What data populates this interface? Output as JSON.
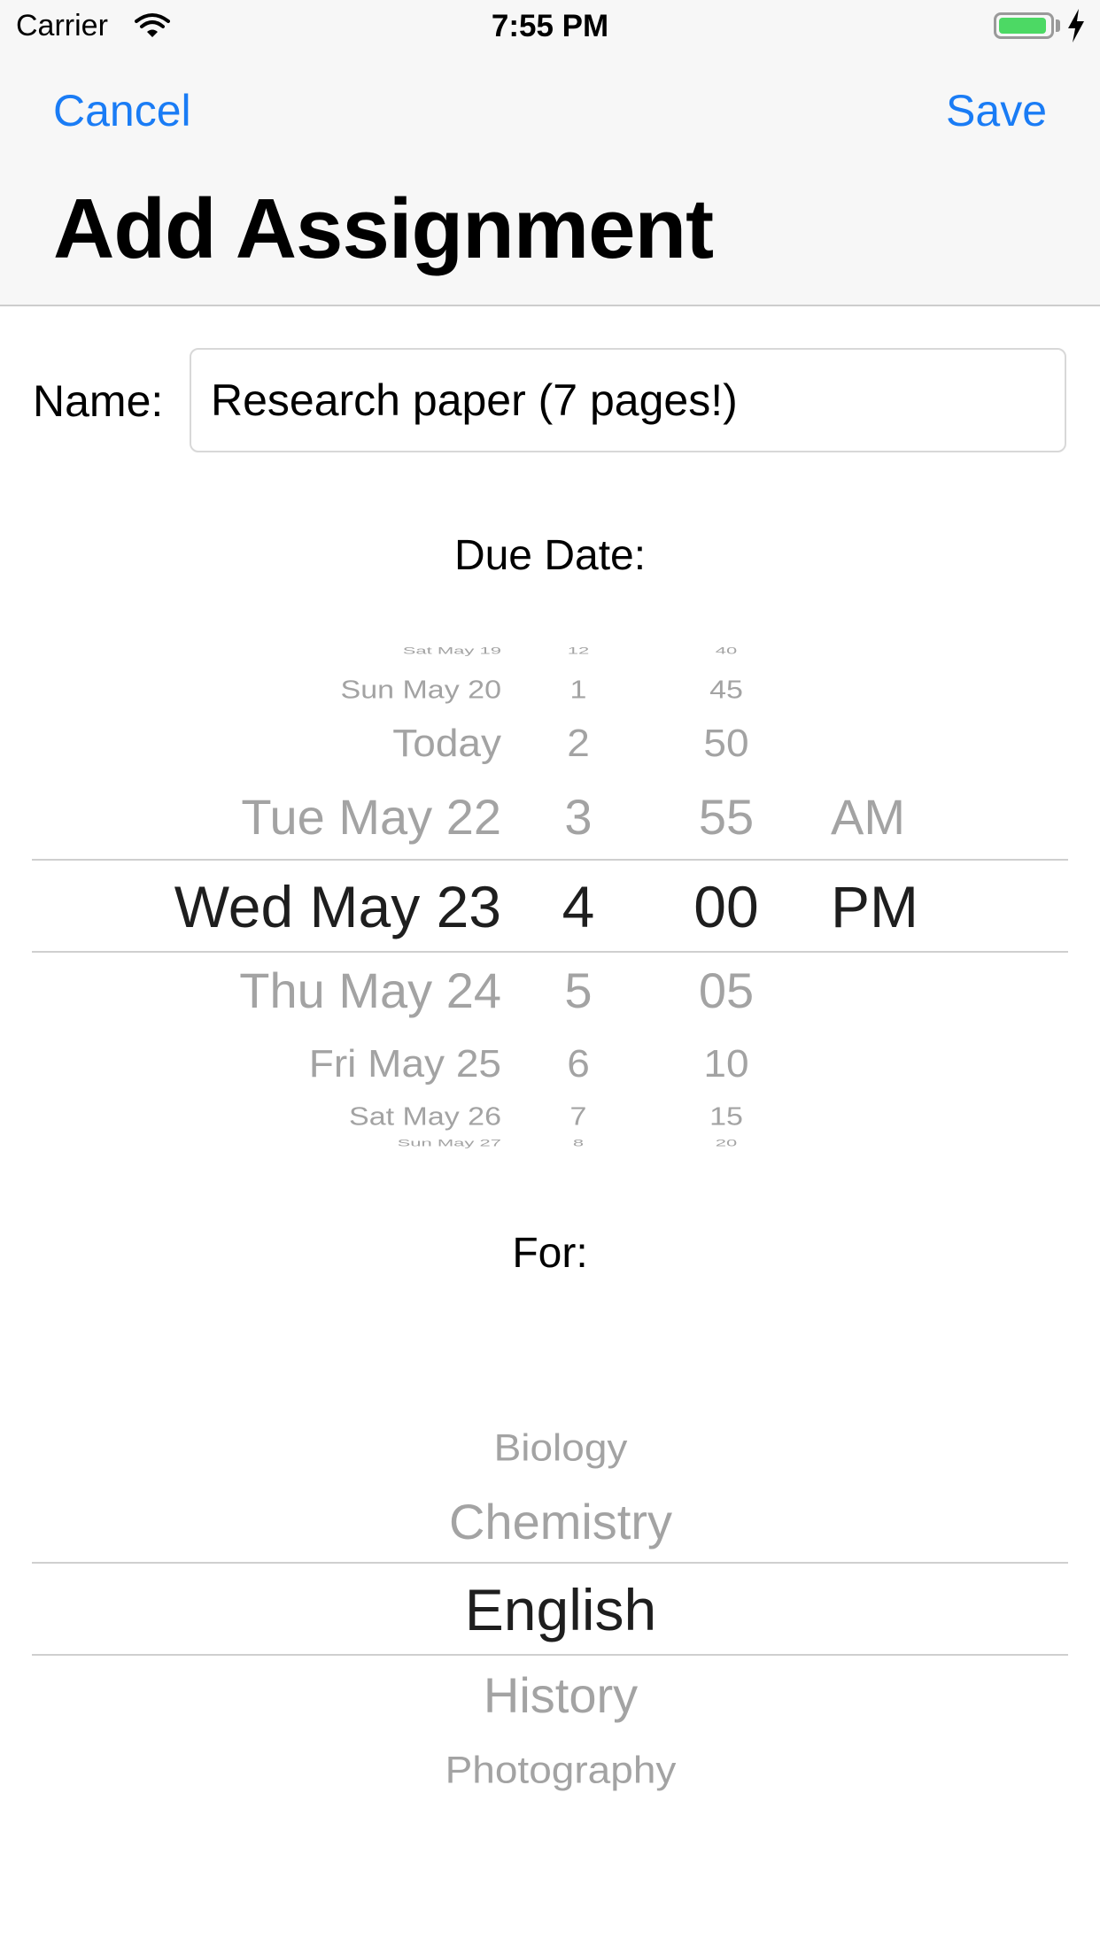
{
  "status_bar": {
    "carrier": "Carrier",
    "time": "7:55 PM",
    "battery_level": 0.95
  },
  "nav": {
    "cancel_label": "Cancel",
    "save_label": "Save",
    "title": "Add Assignment"
  },
  "form": {
    "name_label": "Name:",
    "name_value": "Research paper (7 pages!)",
    "due_label": "Due Date:",
    "for_label": "For:"
  },
  "date_picker": {
    "dates": [
      "Sat May 19",
      "Sun May 20",
      "Today",
      "Tue May 22",
      "Wed May 23",
      "Thu May 24",
      "Fri May 25",
      "Sat May 26",
      "Sun May 27"
    ],
    "hours": [
      "12",
      "1",
      "2",
      "3",
      "4",
      "5",
      "6",
      "7",
      "8"
    ],
    "minutes": [
      "40",
      "45",
      "50",
      "55",
      "00",
      "05",
      "10",
      "15",
      "20"
    ],
    "periods": [
      "AM",
      "PM"
    ],
    "selected": {
      "date": "Wed May 23",
      "hour": "4",
      "minute": "00",
      "period": "PM"
    }
  },
  "subject_picker": {
    "subjects": [
      "Biology",
      "Chemistry",
      "English",
      "History",
      "Photography"
    ],
    "selected": "English"
  }
}
